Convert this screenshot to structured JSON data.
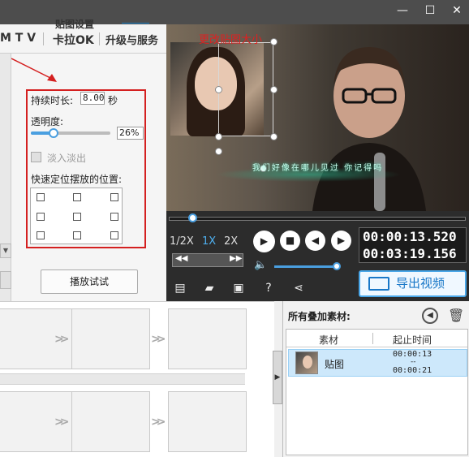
{
  "window": {
    "minimize": "—",
    "maximize": "☐",
    "close": "✕"
  },
  "nav": {
    "items": [
      "M T V",
      "卡拉OK",
      "升级与服务"
    ]
  },
  "sticker_settings": {
    "title": "贴图设置",
    "duration_label": "持续时长:",
    "duration_value": "8.00",
    "duration_unit": "秒",
    "opacity_label": "透明度:",
    "opacity_value": "26%",
    "fade_label": "淡入淡出",
    "position_label": "快速定位摆放的位置:",
    "preview_button": "播放试试"
  },
  "video": {
    "annotation": "更改贴图大小",
    "lyric": "我们好像在哪儿见过 你记得吗"
  },
  "controls": {
    "speeds": [
      "1/2X",
      "1X",
      "2X"
    ],
    "active_speed": "1X",
    "current_time": "00:00:13.520",
    "total_time": "00:03:19.156",
    "export_button": "导出视频"
  },
  "overlay": {
    "title": "所有叠加素材:",
    "columns": [
      "素材",
      "起止时间"
    ],
    "rows": [
      {
        "name": "贴图",
        "start": "00:00:13",
        "sep": "--",
        "end": "00:00:21"
      }
    ]
  },
  "icons": {
    "new": "new-icon",
    "open": "folder-icon",
    "save": "save-icon",
    "help": "help-icon",
    "share": "share-icon"
  }
}
